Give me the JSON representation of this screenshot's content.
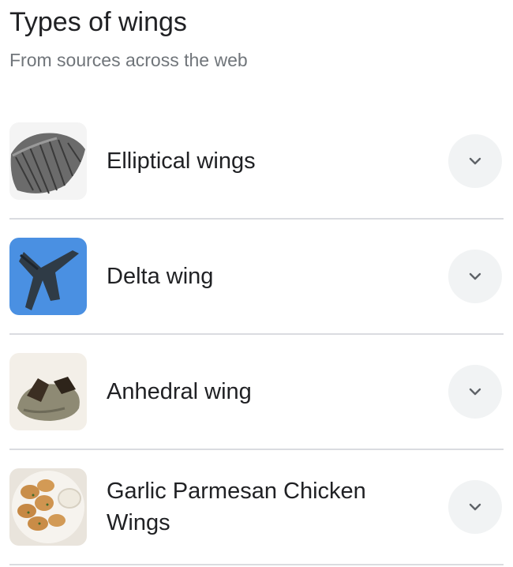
{
  "header": {
    "title": "Types of wings",
    "subtitle": "From sources across the web"
  },
  "items": [
    {
      "label": "Elliptical wings",
      "thumb_icon": "feathered-wing-image"
    },
    {
      "label": "Delta wing",
      "thumb_icon": "delta-wing-jet-image"
    },
    {
      "label": "Anhedral wing",
      "thumb_icon": "rock-mineral-image"
    },
    {
      "label": "Garlic Parmesan Chicken Wings",
      "thumb_icon": "chicken-wings-plate-image"
    }
  ],
  "colors": {
    "divider": "#dadce0",
    "chevron_bg": "#f1f3f4",
    "chevron": "#5f6368",
    "subtitle": "#70757a",
    "sky_blue": "#4a90e2"
  },
  "expand_icon": "chevron-down-icon"
}
